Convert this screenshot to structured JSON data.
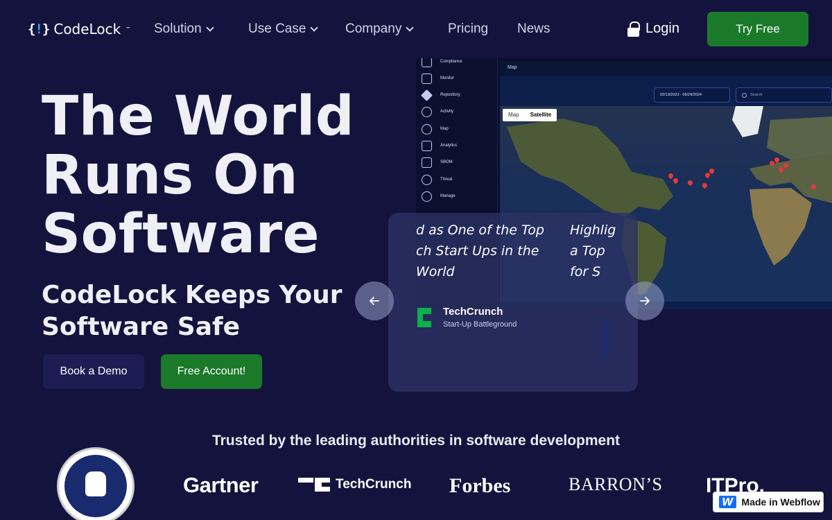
{
  "brand": {
    "name": "CodeLock",
    "mark_open": "{",
    "mark_close": "}",
    "mark_lock": "!",
    "trademark": "™"
  },
  "nav": {
    "items": [
      {
        "label": "Solution",
        "dropdown": true
      },
      {
        "label": "Use Case",
        "dropdown": true
      },
      {
        "label": "Company",
        "dropdown": true
      },
      {
        "label": "Pricing",
        "dropdown": false
      },
      {
        "label": "News",
        "dropdown": false
      }
    ],
    "login": "Login",
    "cta": "Try Free"
  },
  "hero": {
    "title": "The World Runs On Software",
    "subtitle": "CodeLock Keeps Your Software Safe",
    "buttons": {
      "demo": "Book a Demo",
      "free": "Free Account!"
    }
  },
  "dashboard": {
    "sidebar": [
      "Compliance",
      "Monitor",
      "Repository",
      "Activity",
      "Map",
      "Analytics",
      "SBOM",
      "Threat",
      "Manage"
    ],
    "header": "Map",
    "date_range": "02/13/2023 - 06/29/2024",
    "search_placeholder": "Search",
    "map_tabs": [
      "Map",
      "Satellite"
    ]
  },
  "carousel": {
    "current_text": "d as One of the Top\nch Start Ups in the\nWorld",
    "next_text": "Highlig\na Top\nfor S",
    "source": "TechCrunch",
    "tagline": "Start-Up Battleground"
  },
  "trusted": {
    "heading": "Trusted by the leading authorities in software development",
    "logos": {
      "gartner": "Gartner",
      "techcrunch": "TechCrunch",
      "forbes": "Forbes",
      "barrons": "BARRON’S",
      "itpro": "ITPro."
    }
  },
  "badge": {
    "label": "Made in Webflow",
    "logo": "W"
  },
  "colors": {
    "background": "#14133e",
    "accent_green": "#1b7a2a",
    "accent_blue": "#3aa4ff"
  }
}
